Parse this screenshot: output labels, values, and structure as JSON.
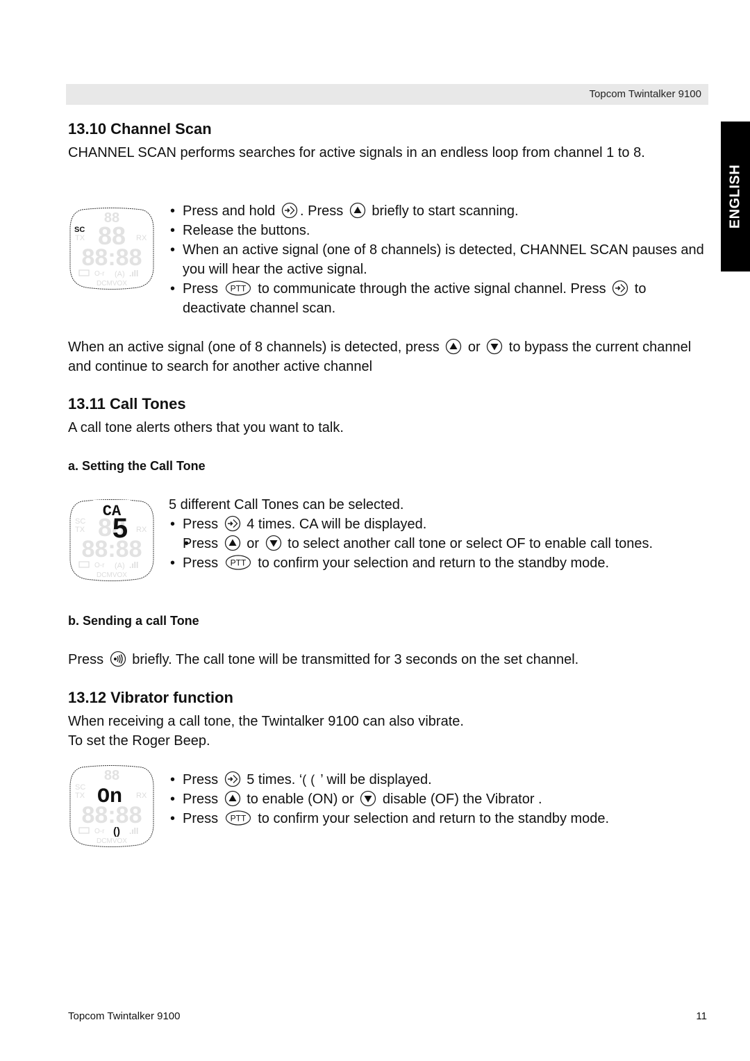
{
  "header": {
    "title": "Topcom Twintalker 9100"
  },
  "language_tab": {
    "label": "ENGLISH"
  },
  "section_13_10": {
    "heading": "13.10 Channel Scan",
    "intro": "CHANNEL SCAN performs searches for active signals in an endless loop from channel 1 to 8.",
    "lcd": {
      "indicator": "SC",
      "icon": "lcd-scan-display"
    },
    "bullets": {
      "b1_a": "Press and hold",
      "b1_b": ". Press",
      "b1_c": "briefly to start scanning.",
      "b2": "Release the buttons.",
      "b3": "When an active signal (one of 8 channels) is detected, CHANNEL SCAN pauses and you will hear the active signal.",
      "b4_a": "Press",
      "b4_b": "to communicate through the active signal channel. Press",
      "b4_c": "to deactivate channel scan."
    },
    "after_a": "When an active signal (one of 8 channels) is detected, press",
    "after_b": "or",
    "after_c": "to bypass the current channel and continue to search for another active channel"
  },
  "section_13_11": {
    "heading": "13.11 Call Tones",
    "intro": "A call tone alerts others that you want to talk.",
    "sub_a": {
      "heading": "a.  Setting the Call Tone",
      "lcd": {
        "top": "CA",
        "digit": "5"
      },
      "line1": "5 different Call Tones can be selected.",
      "b1_a": "Press",
      "b1_b": "4 times. CA will be displayed.",
      "b2_a": "Press",
      "b2_b": "or",
      "b2_c": "to select another call tone or select OF to enable call tones.",
      "b3_a": "Press",
      "b3_b": "to confirm your selection and return to the standby mode."
    },
    "sub_b": {
      "heading": "b.  Sending a call Tone",
      "text_a": "Press",
      "text_b": "briefly. The call tone will be transmitted for 3 seconds on the set channel."
    }
  },
  "section_13_12": {
    "heading": "13.12 Vibrator function",
    "line1": "When receiving a call tone, the Twintalker 9100 can also vibrate.",
    "line2": "To set the Roger Beep.",
    "lcd": {
      "value": "On"
    },
    "b1_a": "Press",
    "b1_b": "5 times. ‘",
    "b1_c": "’ will be displayed.",
    "b2_a": "Press",
    "b2_b": "to enable (ON) or",
    "b2_c": "disable (OF) the Vibrator .",
    "b3_a": "Press",
    "b3_b": "to confirm your selection and return to the standby mode."
  },
  "footer": {
    "left": "Topcom Twintalker 9100",
    "page_number": "11"
  },
  "icons": {
    "menu": "menu-button-icon",
    "up": "up-arrow-button-icon",
    "down": "down-arrow-button-icon",
    "ptt": "ptt-button-icon",
    "call": "call-button-icon",
    "ptt_label": "PTT"
  }
}
